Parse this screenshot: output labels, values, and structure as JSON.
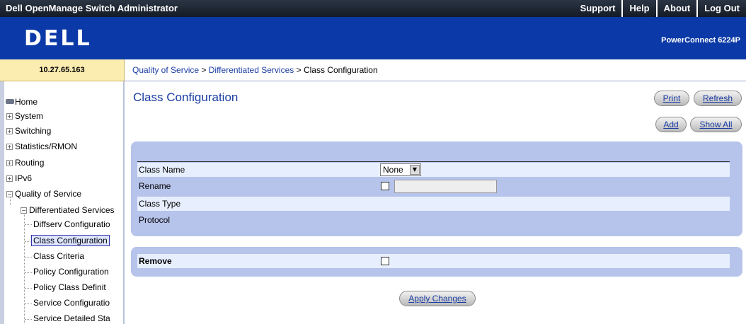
{
  "app": {
    "title": "Dell OpenManage Switch Administrator",
    "top_links": [
      "Support",
      "Help",
      "About",
      "Log Out"
    ],
    "logo": "DELL",
    "model": "PowerConnect 6224P",
    "ip": "10.27.65.163"
  },
  "breadcrumb": {
    "part1": "Quality of Service",
    "sep1": " > ",
    "part2": "Differentiated Services",
    "sep2": " > ",
    "current": "Class Configuration"
  },
  "nav": {
    "home": "Home",
    "system": "System",
    "switching": "Switching",
    "statistics": "Statistics/RMON",
    "routing": "Routing",
    "ipv6": "IPv6",
    "qos": "Quality of Service",
    "diffserv": "Differentiated Services",
    "diffserv_config": "Diffserv Configuratio",
    "class_config": "Class Configuration",
    "class_criteria": "Class Criteria",
    "policy_config": "Policy Configuration",
    "policy_class_def": "Policy Class Definit",
    "service_config": "Service Configuratio",
    "service_detailed": "Service Detailed Sta"
  },
  "page": {
    "title": "Class Configuration",
    "buttons": {
      "print": "Print",
      "refresh": "Refresh",
      "add": "Add",
      "show_all": "Show All",
      "apply": "Apply Changes"
    }
  },
  "form": {
    "class_name_label": "Class Name",
    "class_name_value": "None",
    "rename_label": "Rename",
    "rename_value": "",
    "class_type_label": "Class Type",
    "protocol_label": "Protocol",
    "remove_label": "Remove"
  }
}
